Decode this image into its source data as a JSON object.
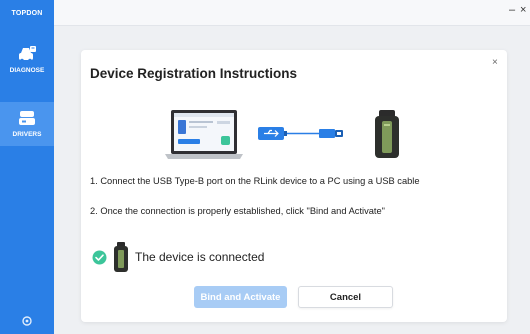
{
  "app": {
    "brand": "TOPDON"
  },
  "sidebar": {
    "items": [
      {
        "label": "DIAGNOSE",
        "icon": "car-diagnose-icon"
      },
      {
        "label": "DRIVERS",
        "icon": "drivers-icon"
      }
    ],
    "settings_icon": "settings-icon"
  },
  "window": {
    "minimize": "–",
    "close": "×"
  },
  "dialog": {
    "title": "Device Registration Instructions",
    "close": "×",
    "steps": [
      "1. Connect the USB Type-B port on the RLink device to a PC using a USB cable",
      "2. Once the connection is properly established, click \"Bind and Activate\""
    ],
    "status": "The device is connected",
    "buttons": {
      "bind": "Bind and Activate",
      "cancel": "Cancel"
    }
  },
  "colors": {
    "accent": "#2a7fe6",
    "success": "#3cc59a",
    "disabled": "#a8ccf5"
  }
}
